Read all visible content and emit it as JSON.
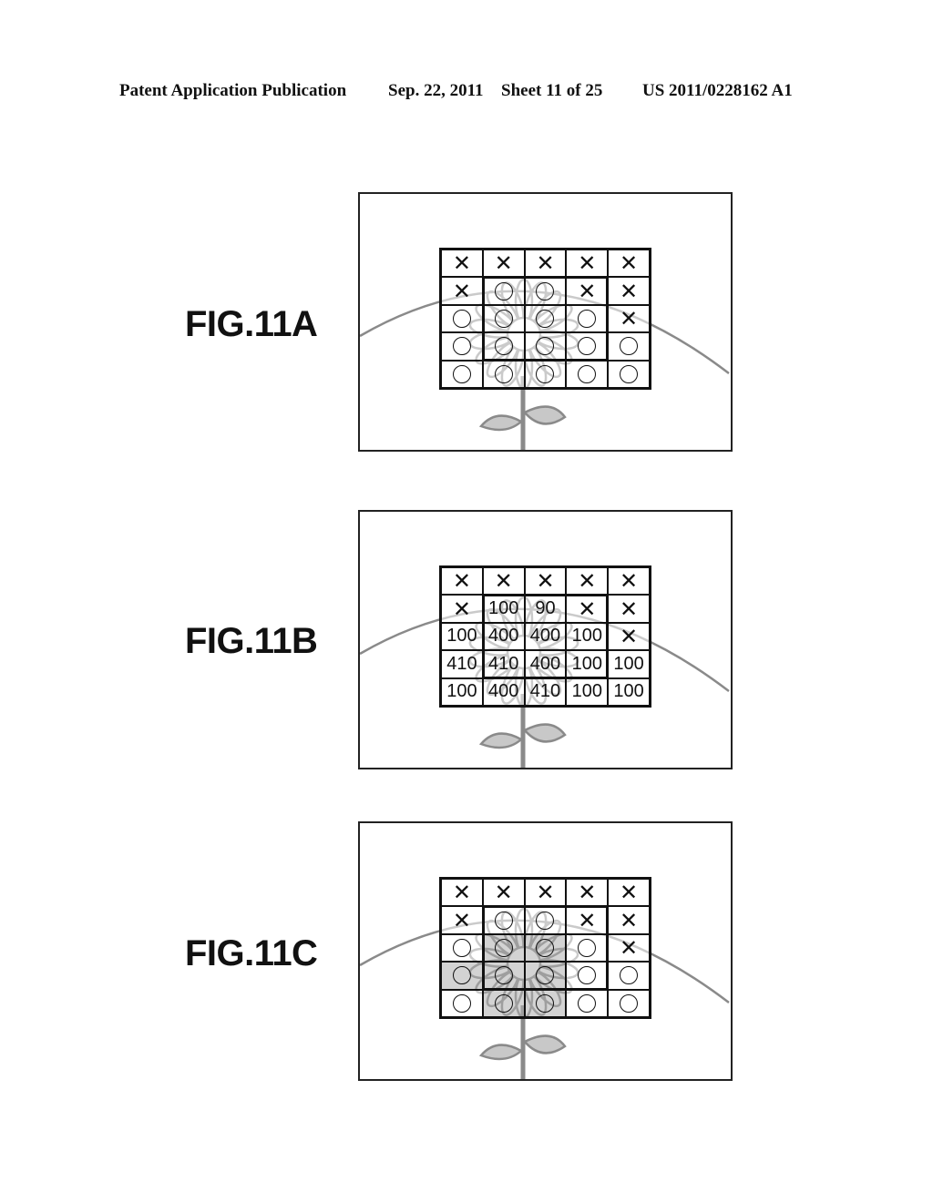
{
  "header": {
    "publication": "Patent Application Publication",
    "date": "Sep. 22, 2011",
    "sheet": "Sheet 11 of 25",
    "number": "US 2011/0228162 A1"
  },
  "legend_symbols": {
    "X": "cross-mark",
    "O": "circle-mark"
  },
  "figures": [
    {
      "label": "FIG.11A",
      "grid": [
        [
          "X",
          "X",
          "X",
          "X",
          "X"
        ],
        [
          "X",
          "O",
          "O",
          "X",
          "X"
        ],
        [
          "O",
          "O",
          "O",
          "O",
          "X"
        ],
        [
          "O",
          "O",
          "O",
          "O",
          "O"
        ],
        [
          "O",
          "O",
          "O",
          "O",
          "O"
        ]
      ],
      "shaded": []
    },
    {
      "label": "FIG.11B",
      "grid": [
        [
          "X",
          "X",
          "X",
          "X",
          "X"
        ],
        [
          "X",
          "100",
          "90",
          "X",
          "X"
        ],
        [
          "100",
          "400",
          "400",
          "100",
          "X"
        ],
        [
          "410",
          "410",
          "400",
          "100",
          "100"
        ],
        [
          "100",
          "400",
          "410",
          "100",
          "100"
        ]
      ],
      "shaded": []
    },
    {
      "label": "FIG.11C",
      "grid": [
        [
          "X",
          "X",
          "X",
          "X",
          "X"
        ],
        [
          "X",
          "O",
          "O",
          "X",
          "X"
        ],
        [
          "O",
          "O",
          "O",
          "O",
          "X"
        ],
        [
          "O",
          "O",
          "O",
          "O",
          "O"
        ],
        [
          "O",
          "O",
          "O",
          "O",
          "O"
        ]
      ],
      "shaded": [
        [
          2,
          1
        ],
        [
          2,
          2
        ],
        [
          3,
          0
        ],
        [
          3,
          1
        ],
        [
          3,
          2
        ],
        [
          4,
          1
        ],
        [
          4,
          2
        ]
      ]
    }
  ]
}
